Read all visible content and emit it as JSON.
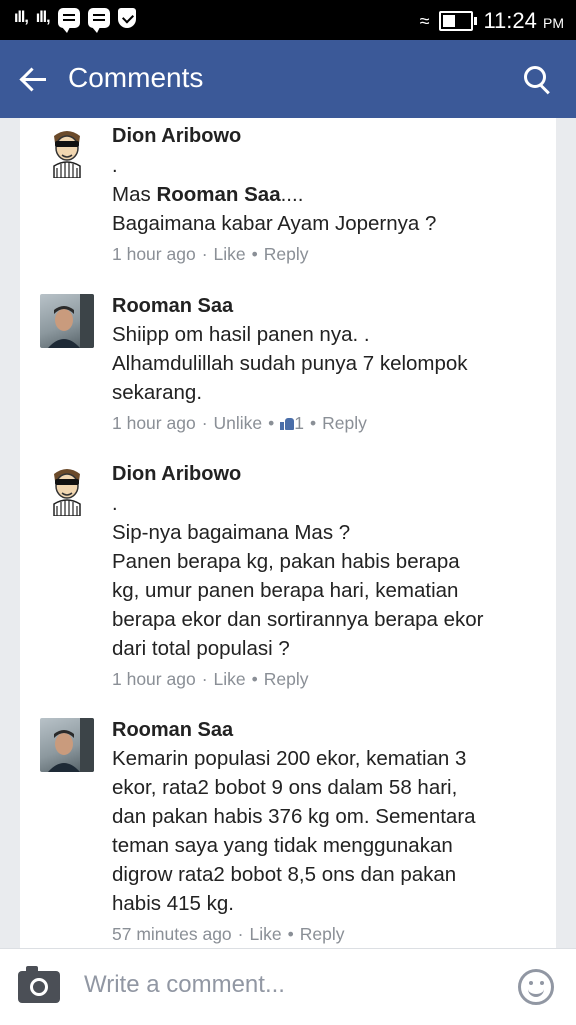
{
  "status_bar": {
    "time": "11:24",
    "ampm": "PM",
    "signal1": "ıll,",
    "signal2": "ıll,"
  },
  "app_bar": {
    "title": "Comments"
  },
  "comments": [
    {
      "author": "Dion Aribowo",
      "dot": ".",
      "lines": [
        "Mas <b>Rooman Saa</b>....",
        "Bagaimana kabar Ayam Jopernya ?"
      ],
      "time": "1 hour ago",
      "action": "Like",
      "reply": "Reply"
    },
    {
      "author": "Rooman Saa",
      "lines": [
        "Shiipp om hasil panen nya. .",
        "Alhamdulillah sudah punya 7 kelompok",
        "sekarang."
      ],
      "time": "1 hour ago",
      "action": "Unlike",
      "like_count": "1",
      "reply": "Reply"
    },
    {
      "author": "Dion Aribowo",
      "dot": ".",
      "lines": [
        "Sip-nya bagaimana Mas ?",
        "Panen berapa kg, pakan habis berapa",
        "kg, umur panen berapa hari, kematian",
        "berapa ekor dan sortirannya berapa ekor",
        "dari total populasi ?"
      ],
      "time": "1 hour ago",
      "action": "Like",
      "reply": "Reply"
    },
    {
      "author": "Rooman Saa",
      "lines": [
        "Kemarin populasi 200 ekor, kematian 3",
        "ekor, rata2 bobot 9 ons dalam 58 hari,",
        "dan pakan habis 376 kg om. Sementara",
        "teman saya yang tidak menggunakan",
        "digrow rata2 bobot 8,5 ons dan pakan",
        "habis 415 kg."
      ],
      "time": "57 minutes ago",
      "action": "Like",
      "reply": "Reply"
    }
  ],
  "composer": {
    "placeholder": "Write a comment..."
  },
  "colors": {
    "brand": "#3b5998",
    "meta": "#8a8f96"
  }
}
